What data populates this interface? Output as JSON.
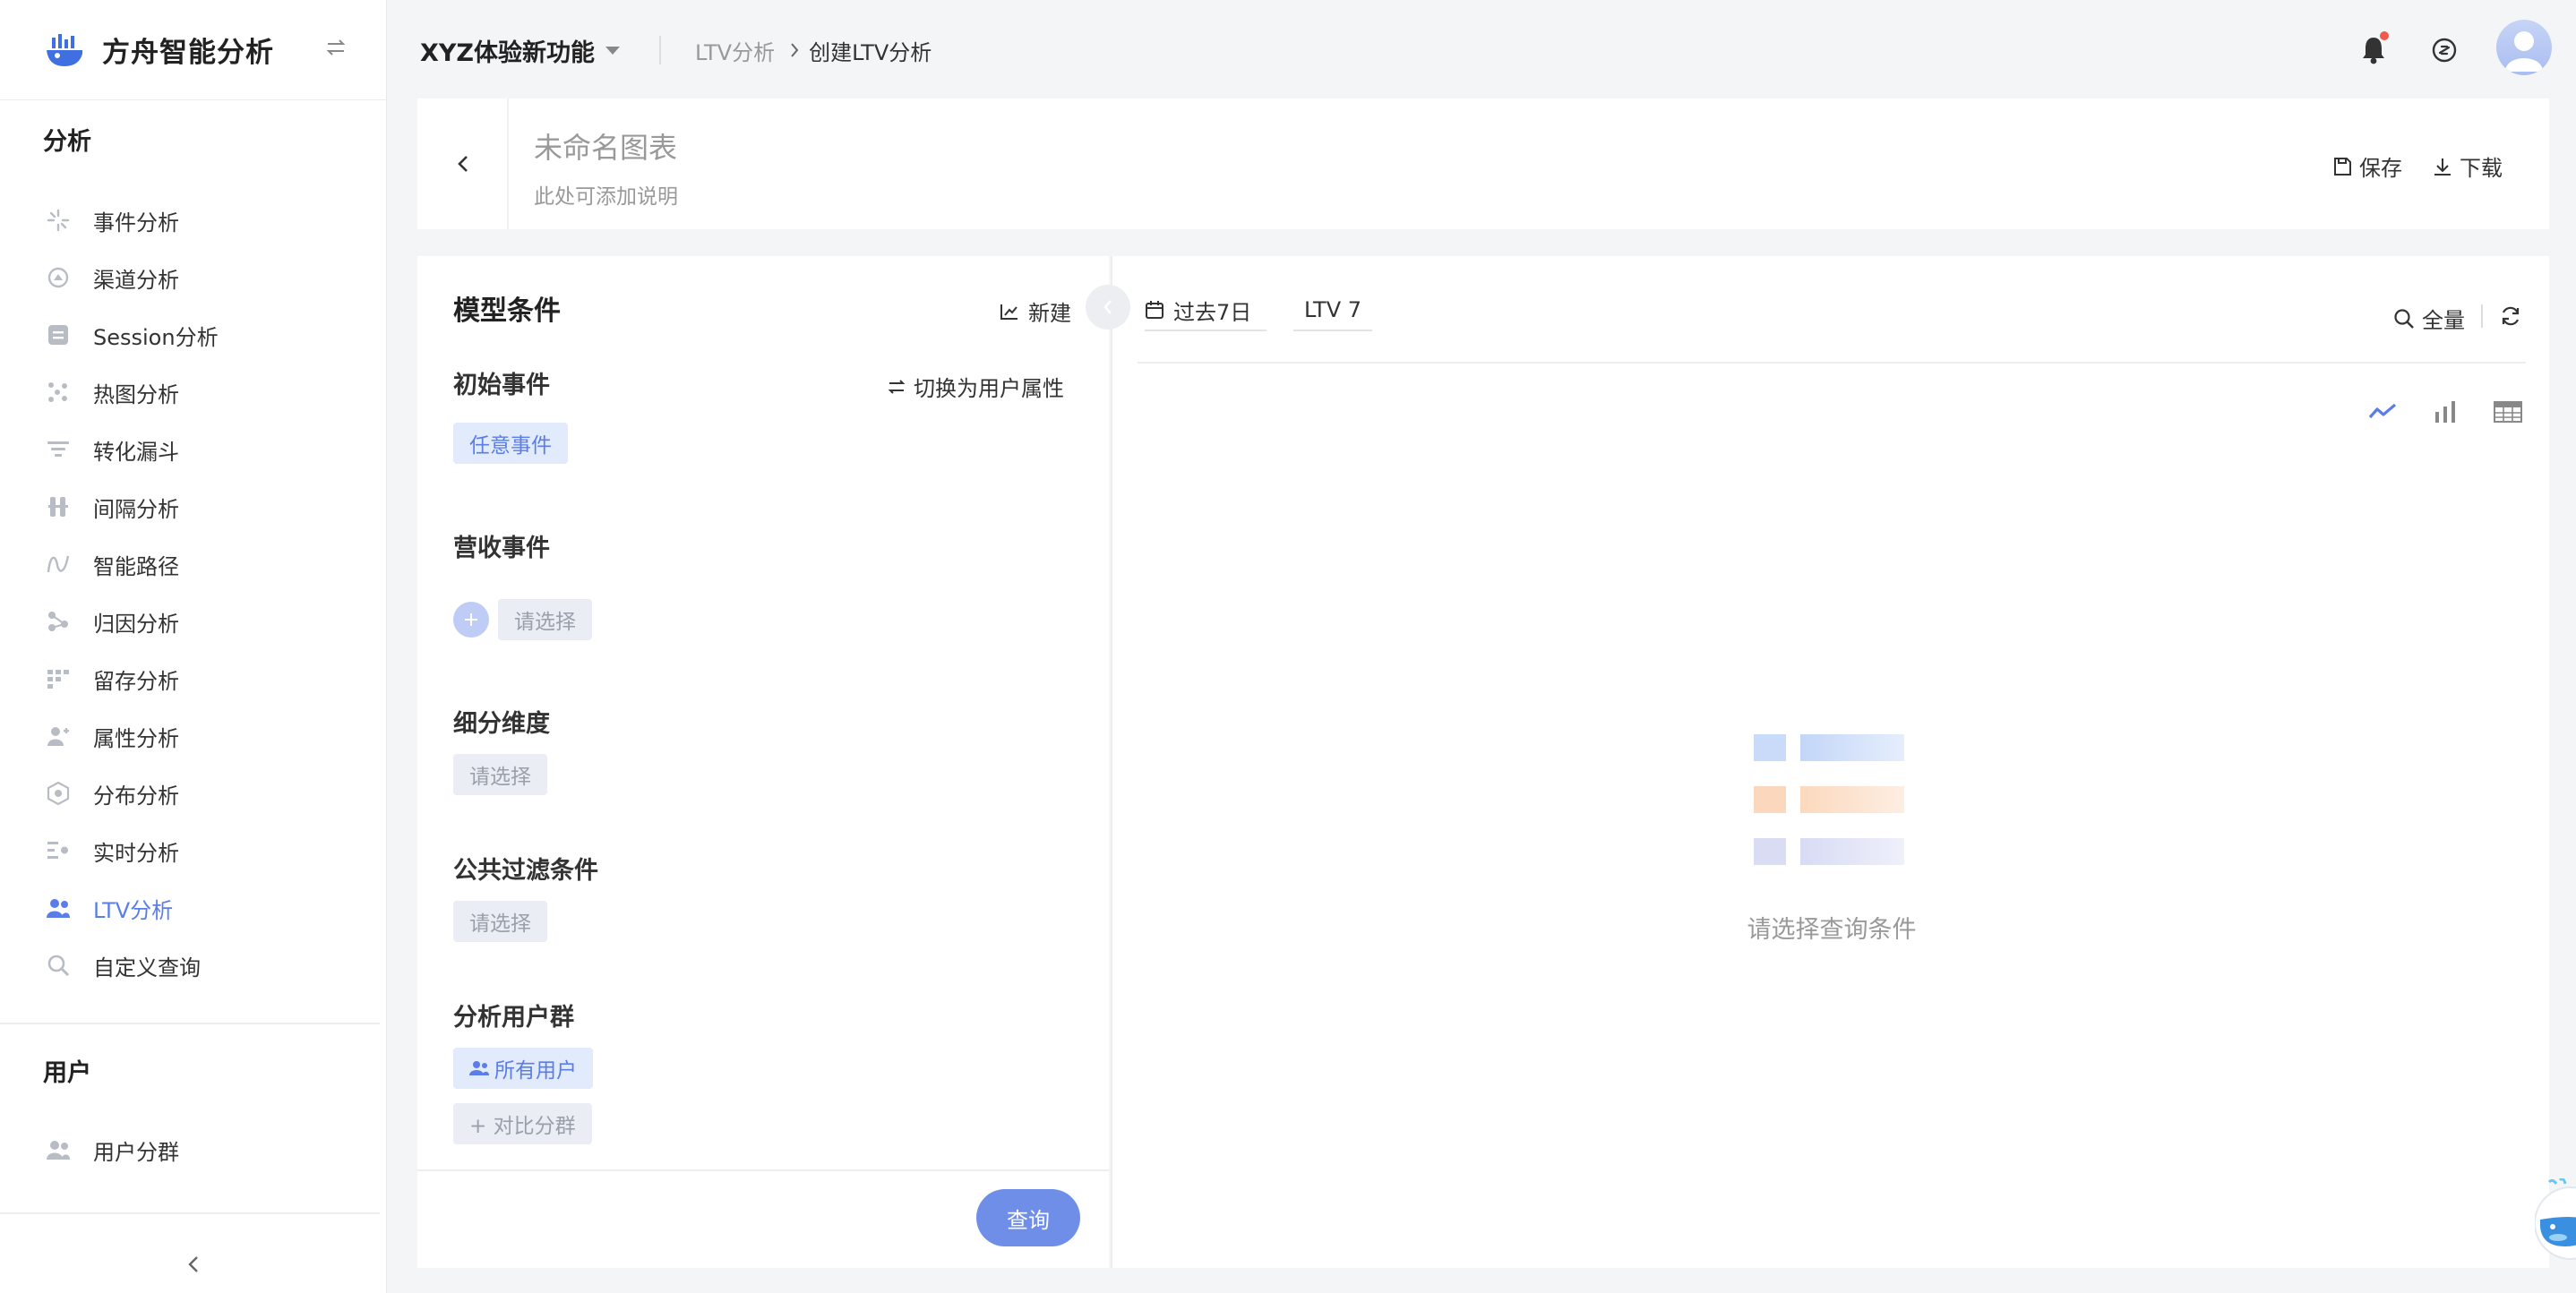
{
  "app": {
    "name": "方舟智能分析"
  },
  "sidebar": {
    "section_analysis": "分析",
    "items": [
      {
        "label": "事件分析",
        "icon": "sparkle-icon"
      },
      {
        "label": "渠道分析",
        "icon": "channel-icon"
      },
      {
        "label": "Session分析",
        "icon": "session-icon"
      },
      {
        "label": "热图分析",
        "icon": "heatmap-icon"
      },
      {
        "label": "转化漏斗",
        "icon": "funnel-icon"
      },
      {
        "label": "间隔分析",
        "icon": "interval-icon"
      },
      {
        "label": "智能路径",
        "icon": "path-icon"
      },
      {
        "label": "归因分析",
        "icon": "attribution-icon"
      },
      {
        "label": "留存分析",
        "icon": "retention-icon"
      },
      {
        "label": "属性分析",
        "icon": "attribute-icon"
      },
      {
        "label": "分布分析",
        "icon": "distribution-icon"
      },
      {
        "label": "实时分析",
        "icon": "realtime-icon"
      },
      {
        "label": "LTV分析",
        "icon": "ltv-icon",
        "active": true
      },
      {
        "label": "自定义查询",
        "icon": "custom-query-icon"
      }
    ],
    "section_user": "用户",
    "user_items": [
      {
        "label": "用户分群",
        "icon": "user-group-icon"
      }
    ]
  },
  "header": {
    "project": "XYZ体验新功能",
    "breadcrumb": [
      "LTV分析",
      "创建LTV分析"
    ]
  },
  "titlebar": {
    "title": "未命名图表",
    "description": "此处可添加说明",
    "save_label": "保存",
    "download_label": "下载"
  },
  "left_panel": {
    "heading": "模型条件",
    "new_label": "新建",
    "initial_event": {
      "label": "初始事件",
      "switch_label": "切换为用户属性",
      "value": "任意事件"
    },
    "revenue_event": {
      "label": "营收事件",
      "placeholder": "请选择"
    },
    "breakdown": {
      "label": "细分维度",
      "placeholder": "请选择"
    },
    "global_filter": {
      "label": "公共过滤条件",
      "placeholder": "请选择"
    },
    "user_group": {
      "label": "分析用户群",
      "value": "所有用户",
      "compare_label": "+ 对比分群"
    },
    "query_label": "查询"
  },
  "right_panel": {
    "date_range": "过去7日",
    "ltv": "LTV 7",
    "full_label": "全量",
    "empty_text": "请选择查询条件"
  },
  "colors": {
    "accent": "#5b7de8",
    "query_button": "#6f8ee8",
    "notification_dot": "#f05a4a"
  }
}
